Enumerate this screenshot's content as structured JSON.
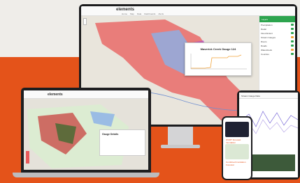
{
  "monitor": {
    "app_logo": "elements",
    "nav": [
      "Home",
      "Map",
      "Data",
      "Dashboards",
      "Alerts"
    ],
    "popup_title": "Maverick Creek Gauge 124",
    "panel_title": "Layers",
    "layers": [
      "Precipitation",
      "Radar",
      "Flood Extent",
      "Stream Gauges",
      "Rivers",
      "Roads",
      "Watersheds",
      "Counties"
    ]
  },
  "laptop": {
    "app_logo": "elements",
    "popup_title": "Gauge Details"
  },
  "tablet": {
    "header": "Stream Gauge Data"
  },
  "phone": {
    "card1": "WCRT Forecast Inundation",
    "card2": "Combined Inundation Forecast"
  },
  "colors": {
    "accent_green": "#2da44e",
    "brand_orange": "#e4531a"
  }
}
